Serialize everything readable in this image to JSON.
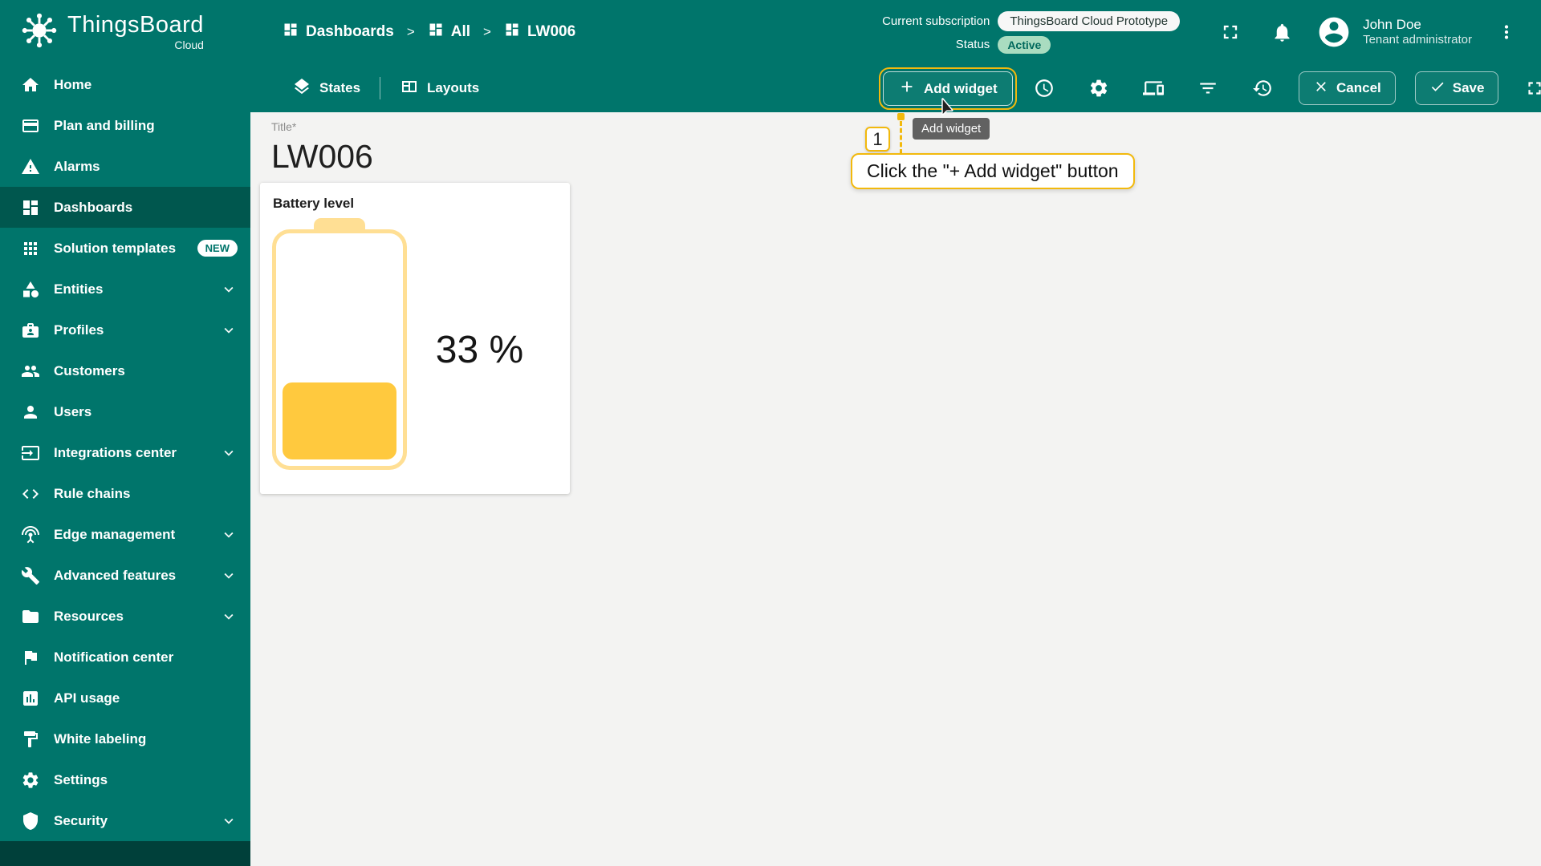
{
  "app": {
    "title": "ThingsBoard",
    "subtitle": "Cloud"
  },
  "breadcrumb": {
    "separator": ">",
    "items": [
      {
        "label": "Dashboards",
        "icon": "dashboard"
      },
      {
        "label": "All",
        "icon": "dashboard"
      },
      {
        "label": "LW006",
        "icon": "dashboard"
      }
    ]
  },
  "header": {
    "subscription_label": "Current subscription",
    "subscription_value": "ThingsBoard Cloud Prototype",
    "status_label": "Status",
    "status_value": "Active",
    "user": {
      "name": "John Doe",
      "role": "Tenant administrator"
    }
  },
  "toolbar": {
    "states_label": "States",
    "layouts_label": "Layouts",
    "add_widget_label": "Add widget",
    "cancel_label": "Cancel",
    "save_label": "Save",
    "icon_buttons": [
      {
        "name": "time-window-button",
        "icon": "clock"
      },
      {
        "name": "dashboard-settings-button",
        "icon": "gear"
      },
      {
        "name": "entity-aliases-button",
        "icon": "devices"
      },
      {
        "name": "filters-button",
        "icon": "filter"
      },
      {
        "name": "version-control-button",
        "icon": "history"
      }
    ]
  },
  "sidebar": {
    "items": [
      {
        "label": "Home",
        "icon": "home"
      },
      {
        "label": "Plan and billing",
        "icon": "credit-card"
      },
      {
        "label": "Alarms",
        "icon": "warning"
      },
      {
        "label": "Dashboards",
        "icon": "dashboard",
        "active": true
      },
      {
        "label": "Solution templates",
        "icon": "apps",
        "badge": "NEW"
      },
      {
        "label": "Entities",
        "icon": "category",
        "expandable": true
      },
      {
        "label": "Profiles",
        "icon": "badge",
        "expandable": true
      },
      {
        "label": "Customers",
        "icon": "people"
      },
      {
        "label": "Users",
        "icon": "person"
      },
      {
        "label": "Integrations center",
        "icon": "input",
        "expandable": true
      },
      {
        "label": "Rule chains",
        "icon": "code"
      },
      {
        "label": "Edge management",
        "icon": "antenna",
        "expandable": true
      },
      {
        "label": "Advanced features",
        "icon": "build",
        "expandable": true
      },
      {
        "label": "Resources",
        "icon": "folder",
        "expandable": true
      },
      {
        "label": "Notification center",
        "icon": "flag"
      },
      {
        "label": "API usage",
        "icon": "chart"
      },
      {
        "label": "White labeling",
        "icon": "paint"
      },
      {
        "label": "Settings",
        "icon": "gear"
      },
      {
        "label": "Security",
        "icon": "shield",
        "expandable": true
      }
    ]
  },
  "content": {
    "title_label": "Title*",
    "title_value": "LW006",
    "widget": {
      "title": "Battery level",
      "value_label": "33 %",
      "percent": 33
    }
  },
  "tutorial": {
    "step_number": "1",
    "tooltip": "Add widget",
    "callout": "Click the \"+ Add widget\" button"
  },
  "colors": {
    "primary": "#00756B",
    "primary_dark": "#00574E",
    "highlight": "#F2B90D",
    "battery_fill": "#FFC93E",
    "battery_outline": "#FFDF94",
    "active_badge_bg": "#A9DCC0",
    "tooltip_bg": "#616161",
    "content_bg": "#F3F3F2"
  }
}
